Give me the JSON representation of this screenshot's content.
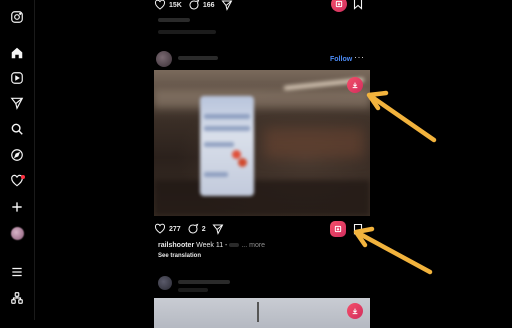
{
  "sidebar": {
    "items": [
      {
        "icon": "instagram-logo-icon"
      },
      {
        "icon": "home-icon"
      },
      {
        "icon": "reels-icon"
      },
      {
        "icon": "direct-messages-icon"
      },
      {
        "icon": "search-icon"
      },
      {
        "icon": "explore-icon"
      },
      {
        "icon": "notifications-heart-icon"
      },
      {
        "icon": "create-plus-icon"
      },
      {
        "icon": "profile-avatar"
      },
      {
        "icon": "menu-icon"
      },
      {
        "icon": "threads-also-from-meta-icon"
      }
    ]
  },
  "post_top": {
    "likes": "15K",
    "comments": "166"
  },
  "post_main": {
    "follow_label": "Follow",
    "more_label": "···",
    "likes": "277",
    "comments": "2",
    "caption_user": "railshooter",
    "caption_text": " Week 11 - ",
    "caption_more": "... more",
    "see_translation": "See translation"
  },
  "post_next": {
    "follow_label": ""
  },
  "colors": {
    "background": "#000000",
    "download_button": "#e23d63",
    "follow_blue": "#4c8bf5",
    "arrow_yellow": "#f2b33d"
  }
}
